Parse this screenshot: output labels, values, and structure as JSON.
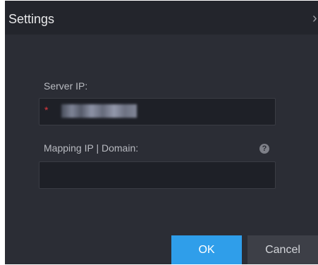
{
  "dialog": {
    "title": "Settings",
    "close_glyph": "›"
  },
  "form": {
    "server_ip": {
      "label": "Server IP:",
      "required_mark": "*",
      "value": ""
    },
    "mapping": {
      "label": "Mapping IP | Domain:",
      "help_glyph": "?",
      "value": ""
    }
  },
  "buttons": {
    "ok_label": "OK",
    "cancel_label": "Cancel"
  },
  "colors": {
    "accent": "#2f9eea",
    "required": "#e0383e",
    "dialog_bg": "#2b2d35"
  }
}
